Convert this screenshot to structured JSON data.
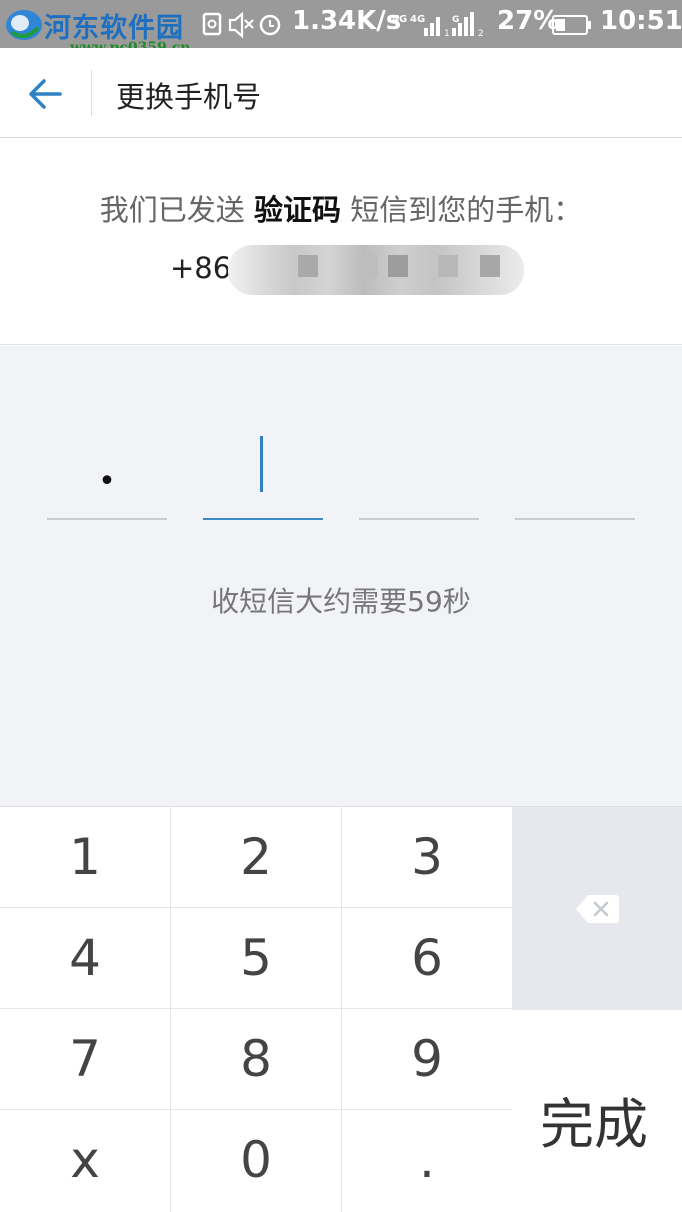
{
  "status_bar": {
    "watermark_title": "河东软件园",
    "watermark_url": "www.pc0359.cn",
    "net_speed": "1.34K/s",
    "battery_percent": "27%",
    "time": "10:51"
  },
  "header": {
    "title": "更换手机号"
  },
  "info": {
    "sent_prefix": "我们已发送 ",
    "sent_bold": "验证码",
    "sent_suffix": " 短信到您的手机：",
    "phone_prefix": "+86"
  },
  "code": {
    "slots": [
      "•",
      "",
      "",
      ""
    ],
    "active_index": 1,
    "countdown": "收短信大约需要59秒"
  },
  "keypad": {
    "keys": [
      "1",
      "2",
      "3",
      "4",
      "5",
      "6",
      "7",
      "8",
      "9",
      "x",
      "0",
      "."
    ],
    "done_label": "完成"
  },
  "colors": {
    "accent": "#2f82c4",
    "status_bar": "#9a9a9a",
    "code_bg": "#f2f3f7",
    "delete_bg": "#e6e8ed"
  }
}
